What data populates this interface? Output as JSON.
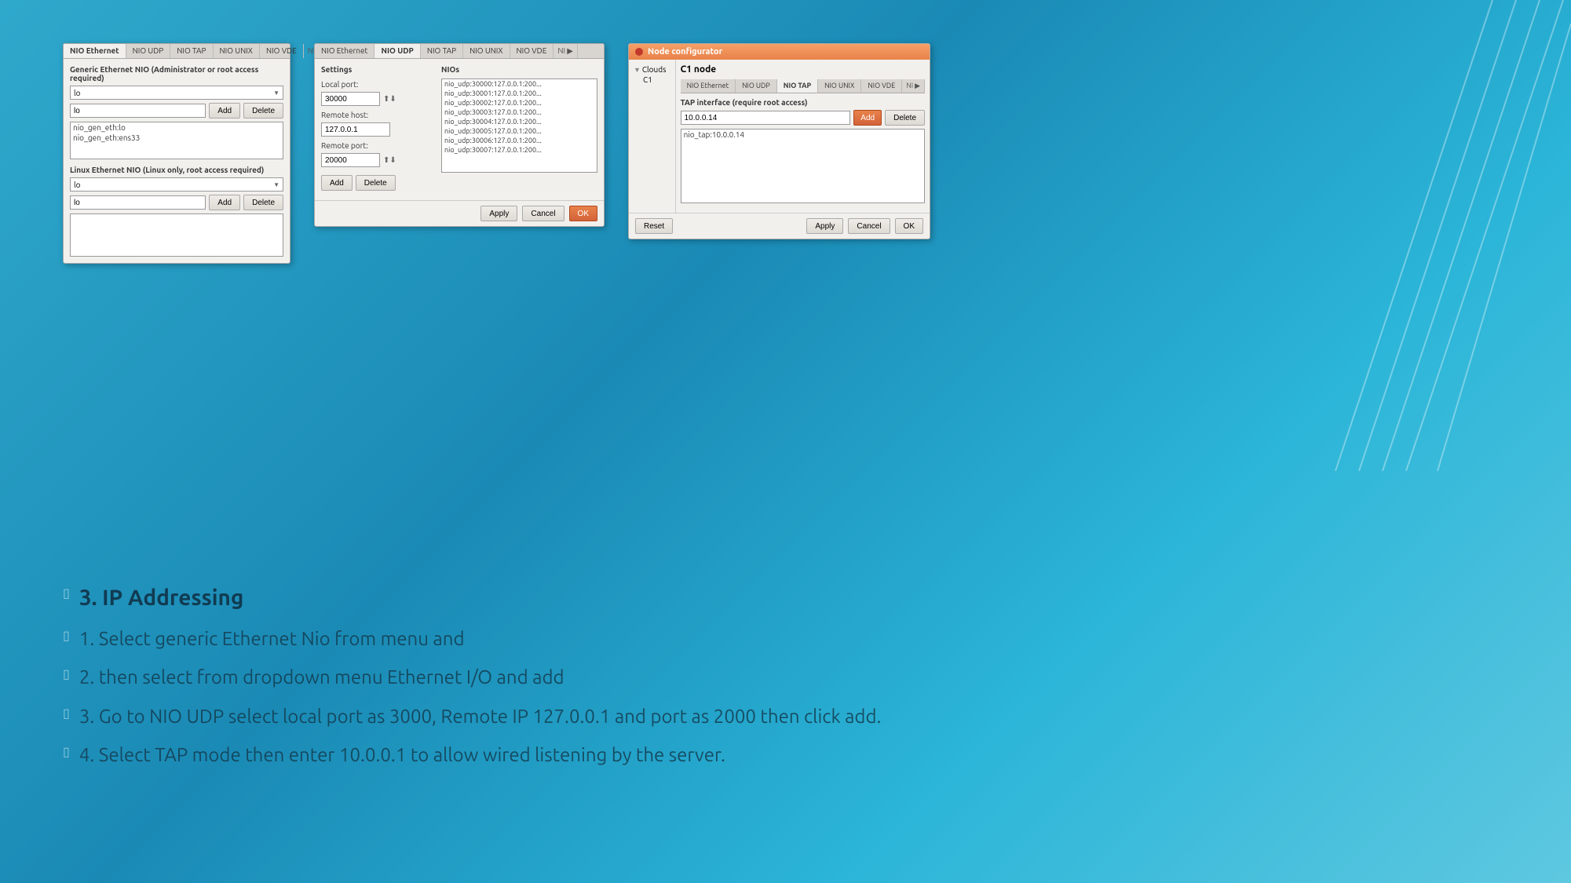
{
  "background": {
    "gradient_start": "#2fa8cc",
    "gradient_end": "#5ec8e0"
  },
  "dialog1": {
    "tabs": [
      "NIO Ethernet",
      "NIO UDP",
      "NIO TAP",
      "NIO UNIX",
      "NIO VDE",
      "NI ▶"
    ],
    "active_tab": "NIO Ethernet",
    "section1_label": "Generic Ethernet NIO (Administrator or root access required)",
    "dropdown_value": "lo",
    "input1_value": "lo",
    "add_btn": "Add",
    "delete_btn": "Delete",
    "list_items": [
      "nio_gen_eth:lo",
      "nio_gen_eth:ens33"
    ],
    "section2_label": "Linux Ethernet NIO (Linux only, root access required)",
    "dropdown2_value": "lo",
    "input2_value": "lo",
    "add_btn2": "Add",
    "delete_btn2": "Delete"
  },
  "dialog2": {
    "title": "",
    "tabs": [
      "NIO Ethernet",
      "NIO UDP",
      "NIO TAP",
      "NIO UNIX",
      "NIO VDE",
      "NI ▶"
    ],
    "active_tab": "NIO UDP",
    "settings_label": "Settings",
    "nios_label": "NIOs",
    "local_port_label": "Local port:",
    "local_port_value": "30000",
    "remote_host_label": "Remote host:",
    "remote_host_value": "127.0.0.1",
    "remote_port_label": "Remote port:",
    "remote_port_value": "20000",
    "add_btn": "Add",
    "delete_btn": "Delete",
    "nios_list": [
      "nio_udp:30000:127.0.0.1:200...",
      "nio_udp:30001:127.0.0.1:200...",
      "nio_udp:30002:127.0.0.1:200...",
      "nio_udp:30003:127.0.0.1:200...",
      "nio_udp:30004:127.0.0.1:200...",
      "nio_udp:30005:127.0.0.1:200...",
      "nio_udp:30006:127.0.0.1:200...",
      "nio_udp:30007:127.0.0.1:200..."
    ],
    "apply_btn": "Apply",
    "cancel_btn": "Cancel",
    "ok_btn": "OK"
  },
  "dialog3": {
    "title": "Node configurator",
    "titlebar_dot": "●",
    "tree_parent": "Clouds",
    "tree_child": "C1",
    "node_title": "C1 node",
    "tabs": [
      "NIO Ethernet",
      "NIO UDP",
      "NIO TAP",
      "NIO UNIX",
      "NIO VDE",
      "NI ▶"
    ],
    "active_tab": "NIO TAP",
    "tap_section_label": "TAP interface (require root access)",
    "tap_input_value": "10.0.0.14",
    "add_btn": "Add",
    "delete_btn": "Delete",
    "list_items": [
      "nio_tap:10.0.0.14"
    ],
    "reset_btn": "Reset",
    "apply_btn": "Apply",
    "cancel_btn": "Cancel",
    "ok_btn": "OK"
  },
  "content": {
    "section_title": "3. IP Addressing",
    "items": [
      {
        "text": "1. Select generic Ethernet Nio from menu and"
      },
      {
        "text": "2. then select from dropdown menu Ethernet I/O and add"
      },
      {
        "text": "3. Go to NIO UDP select local port as 3000, Remote IP 127.0.0.1 and port as 2000 then click add."
      },
      {
        "text": "4. Select TAP mode then enter 10.0.0.1 to allow wired listening by the server."
      }
    ]
  }
}
